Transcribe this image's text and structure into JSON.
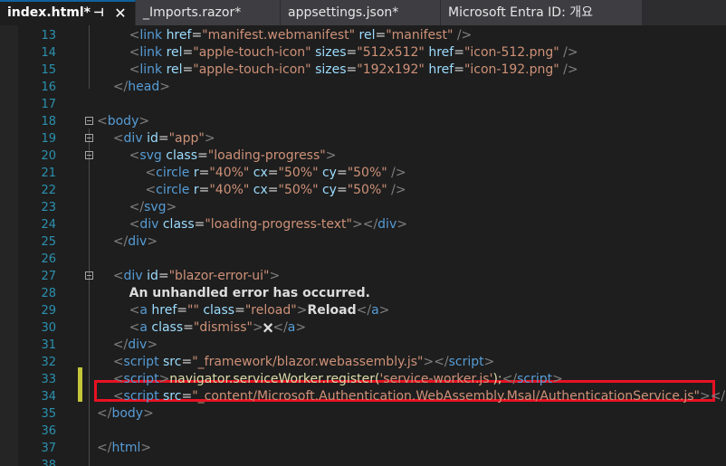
{
  "tabs": [
    {
      "label": "index.html*",
      "active": true
    },
    {
      "label": "_Imports.razor*",
      "active": false
    },
    {
      "label": "appsettings.json*",
      "active": false
    },
    {
      "label": "Microsoft Entra ID: 개요",
      "active": false
    }
  ],
  "tab_icons": {
    "pin": "pin-icon",
    "close": "close-icon"
  },
  "colors": {
    "tag": "#569cd6",
    "attribute": "#9cdcfe",
    "value": "#ce9178",
    "text": "#dcdcdc",
    "line_number": "#2b91af",
    "highlight_box": "#e81123",
    "change_indicator": "#c5c53a"
  },
  "lines": [
    {
      "n": "13",
      "tokens": [
        [
          "i",
          "        "
        ],
        [
          "b",
          "<"
        ],
        [
          "n",
          "link"
        ],
        [
          "t",
          " "
        ],
        [
          "a",
          "href"
        ],
        [
          "t",
          "="
        ],
        [
          "v",
          "\"manifest.webmanifest\""
        ],
        [
          "t",
          " "
        ],
        [
          "a",
          "rel"
        ],
        [
          "t",
          "="
        ],
        [
          "v",
          "\"manifest\""
        ],
        [
          "t",
          " "
        ],
        [
          "b",
          "/>"
        ]
      ]
    },
    {
      "n": "14",
      "tokens": [
        [
          "i",
          "        "
        ],
        [
          "b",
          "<"
        ],
        [
          "n",
          "link"
        ],
        [
          "t",
          " "
        ],
        [
          "a",
          "rel"
        ],
        [
          "t",
          "="
        ],
        [
          "v",
          "\"apple-touch-icon\""
        ],
        [
          "t",
          " "
        ],
        [
          "a",
          "sizes"
        ],
        [
          "t",
          "="
        ],
        [
          "v",
          "\"512x512\""
        ],
        [
          "t",
          " "
        ],
        [
          "a",
          "href"
        ],
        [
          "t",
          "="
        ],
        [
          "v",
          "\"icon-512.png\""
        ],
        [
          "t",
          " "
        ],
        [
          "b",
          "/>"
        ]
      ]
    },
    {
      "n": "15",
      "tokens": [
        [
          "i",
          "        "
        ],
        [
          "b",
          "<"
        ],
        [
          "n",
          "link"
        ],
        [
          "t",
          " "
        ],
        [
          "a",
          "rel"
        ],
        [
          "t",
          "="
        ],
        [
          "v",
          "\"apple-touch-icon\""
        ],
        [
          "t",
          " "
        ],
        [
          "a",
          "sizes"
        ],
        [
          "t",
          "="
        ],
        [
          "v",
          "\"192x192\""
        ],
        [
          "t",
          " "
        ],
        [
          "a",
          "href"
        ],
        [
          "t",
          "="
        ],
        [
          "v",
          "\"icon-192.png\""
        ],
        [
          "t",
          " "
        ],
        [
          "b",
          "/>"
        ]
      ]
    },
    {
      "n": "16",
      "tokens": [
        [
          "i",
          "    "
        ],
        [
          "b",
          "</"
        ],
        [
          "n",
          "head"
        ],
        [
          "b",
          ">"
        ]
      ]
    },
    {
      "n": "17",
      "tokens": []
    },
    {
      "n": "18",
      "tokens": [
        [
          "b",
          "<"
        ],
        [
          "n",
          "body"
        ],
        [
          "b",
          ">"
        ]
      ]
    },
    {
      "n": "19",
      "tokens": [
        [
          "i",
          "    "
        ],
        [
          "b",
          "<"
        ],
        [
          "n",
          "div"
        ],
        [
          "t",
          " "
        ],
        [
          "a",
          "id"
        ],
        [
          "t",
          "="
        ],
        [
          "v",
          "\"app\""
        ],
        [
          "b",
          ">"
        ]
      ]
    },
    {
      "n": "20",
      "tokens": [
        [
          "i",
          "        "
        ],
        [
          "b",
          "<"
        ],
        [
          "n",
          "svg"
        ],
        [
          "t",
          " "
        ],
        [
          "a",
          "class"
        ],
        [
          "t",
          "="
        ],
        [
          "v",
          "\"loading-progress\""
        ],
        [
          "b",
          ">"
        ]
      ]
    },
    {
      "n": "21",
      "tokens": [
        [
          "i",
          "            "
        ],
        [
          "b",
          "<"
        ],
        [
          "n",
          "circle"
        ],
        [
          "t",
          " "
        ],
        [
          "a",
          "r"
        ],
        [
          "t",
          "="
        ],
        [
          "v",
          "\"40%\""
        ],
        [
          "t",
          " "
        ],
        [
          "a",
          "cx"
        ],
        [
          "t",
          "="
        ],
        [
          "v",
          "\"50%\""
        ],
        [
          "t",
          " "
        ],
        [
          "a",
          "cy"
        ],
        [
          "t",
          "="
        ],
        [
          "v",
          "\"50%\""
        ],
        [
          "t",
          " "
        ],
        [
          "b",
          "/>"
        ]
      ]
    },
    {
      "n": "22",
      "tokens": [
        [
          "i",
          "            "
        ],
        [
          "b",
          "<"
        ],
        [
          "n",
          "circle"
        ],
        [
          "t",
          " "
        ],
        [
          "a",
          "r"
        ],
        [
          "t",
          "="
        ],
        [
          "v",
          "\"40%\""
        ],
        [
          "t",
          " "
        ],
        [
          "a",
          "cx"
        ],
        [
          "t",
          "="
        ],
        [
          "v",
          "\"50%\""
        ],
        [
          "t",
          " "
        ],
        [
          "a",
          "cy"
        ],
        [
          "t",
          "="
        ],
        [
          "v",
          "\"50%\""
        ],
        [
          "t",
          " "
        ],
        [
          "b",
          "/>"
        ]
      ]
    },
    {
      "n": "23",
      "tokens": [
        [
          "i",
          "        "
        ],
        [
          "b",
          "</"
        ],
        [
          "n",
          "svg"
        ],
        [
          "b",
          ">"
        ]
      ]
    },
    {
      "n": "24",
      "tokens": [
        [
          "i",
          "        "
        ],
        [
          "b",
          "<"
        ],
        [
          "n",
          "div"
        ],
        [
          "t",
          " "
        ],
        [
          "a",
          "class"
        ],
        [
          "t",
          "="
        ],
        [
          "v",
          "\"loading-progress-text\""
        ],
        [
          "b",
          ">"
        ],
        [
          "b",
          "</"
        ],
        [
          "n",
          "div"
        ],
        [
          "b",
          ">"
        ]
      ]
    },
    {
      "n": "25",
      "tokens": [
        [
          "i",
          "    "
        ],
        [
          "b",
          "</"
        ],
        [
          "n",
          "div"
        ],
        [
          "b",
          ">"
        ]
      ]
    },
    {
      "n": "26",
      "tokens": []
    },
    {
      "n": "27",
      "tokens": [
        [
          "i",
          "    "
        ],
        [
          "b",
          "<"
        ],
        [
          "n",
          "div"
        ],
        [
          "t",
          " "
        ],
        [
          "a",
          "id"
        ],
        [
          "t",
          "="
        ],
        [
          "v",
          "\"blazor-error-ui\""
        ],
        [
          "b",
          ">"
        ]
      ]
    },
    {
      "n": "28",
      "tokens": [
        [
          "i",
          "        "
        ],
        [
          "k",
          "An unhandled error has occurred."
        ]
      ]
    },
    {
      "n": "29",
      "tokens": [
        [
          "i",
          "        "
        ],
        [
          "b",
          "<"
        ],
        [
          "n",
          "a"
        ],
        [
          "t",
          " "
        ],
        [
          "a",
          "href"
        ],
        [
          "t",
          "="
        ],
        [
          "v",
          "\"\""
        ],
        [
          "t",
          " "
        ],
        [
          "a",
          "class"
        ],
        [
          "t",
          "="
        ],
        [
          "v",
          "\"reload\""
        ],
        [
          "b",
          ">"
        ],
        [
          "k",
          "Reload"
        ],
        [
          "b",
          "</"
        ],
        [
          "n",
          "a"
        ],
        [
          "b",
          ">"
        ]
      ]
    },
    {
      "n": "30",
      "tokens": [
        [
          "i",
          "        "
        ],
        [
          "b",
          "<"
        ],
        [
          "n",
          "a"
        ],
        [
          "t",
          " "
        ],
        [
          "a",
          "class"
        ],
        [
          "t",
          "="
        ],
        [
          "v",
          "\"dismiss\""
        ],
        [
          "b",
          ">"
        ],
        [
          "k",
          "🗙"
        ],
        [
          "b",
          "</"
        ],
        [
          "n",
          "a"
        ],
        [
          "b",
          ">"
        ]
      ]
    },
    {
      "n": "31",
      "tokens": [
        [
          "i",
          "    "
        ],
        [
          "b",
          "</"
        ],
        [
          "n",
          "div"
        ],
        [
          "b",
          ">"
        ]
      ]
    },
    {
      "n": "32",
      "tokens": [
        [
          "i",
          "    "
        ],
        [
          "b",
          "<"
        ],
        [
          "n",
          "script"
        ],
        [
          "t",
          " "
        ],
        [
          "a",
          "src"
        ],
        [
          "t",
          "="
        ],
        [
          "v",
          "\"_framework/blazor.webassembly.js\""
        ],
        [
          "b",
          ">"
        ],
        [
          "b",
          "</"
        ],
        [
          "n",
          "script"
        ],
        [
          "b",
          ">"
        ]
      ]
    },
    {
      "n": "33",
      "tokens": [
        [
          "i",
          "    "
        ],
        [
          "b",
          "<"
        ],
        [
          "n",
          "script"
        ],
        [
          "b",
          ">"
        ],
        [
          "j",
          "navigator.serviceWorker.register("
        ],
        [
          "v",
          "'service-worker.js'"
        ],
        [
          "j",
          ");"
        ],
        [
          "b",
          "</"
        ],
        [
          "n",
          "script"
        ],
        [
          "b",
          ">"
        ]
      ]
    },
    {
      "n": "34",
      "tokens": [
        [
          "i",
          "    "
        ],
        [
          "b",
          "<"
        ],
        [
          "n",
          "script"
        ],
        [
          "t",
          " "
        ],
        [
          "a",
          "src"
        ],
        [
          "t",
          "="
        ],
        [
          "v",
          "\"_content/Microsoft.Authentication.WebAssembly.Msal/AuthenticationService.js\""
        ],
        [
          "b",
          ">"
        ],
        [
          "b",
          "</"
        ],
        [
          "n",
          "script"
        ],
        [
          "b",
          ">"
        ]
      ]
    },
    {
      "n": "35",
      "tokens": [
        [
          "b",
          "</"
        ],
        [
          "n",
          "body"
        ],
        [
          "b",
          ">"
        ]
      ]
    },
    {
      "n": "36",
      "tokens": []
    },
    {
      "n": "37",
      "tokens": [
        [
          "b",
          "</"
        ],
        [
          "n",
          "html"
        ],
        [
          "b",
          ">"
        ]
      ]
    },
    {
      "n": "38",
      "tokens": []
    }
  ]
}
